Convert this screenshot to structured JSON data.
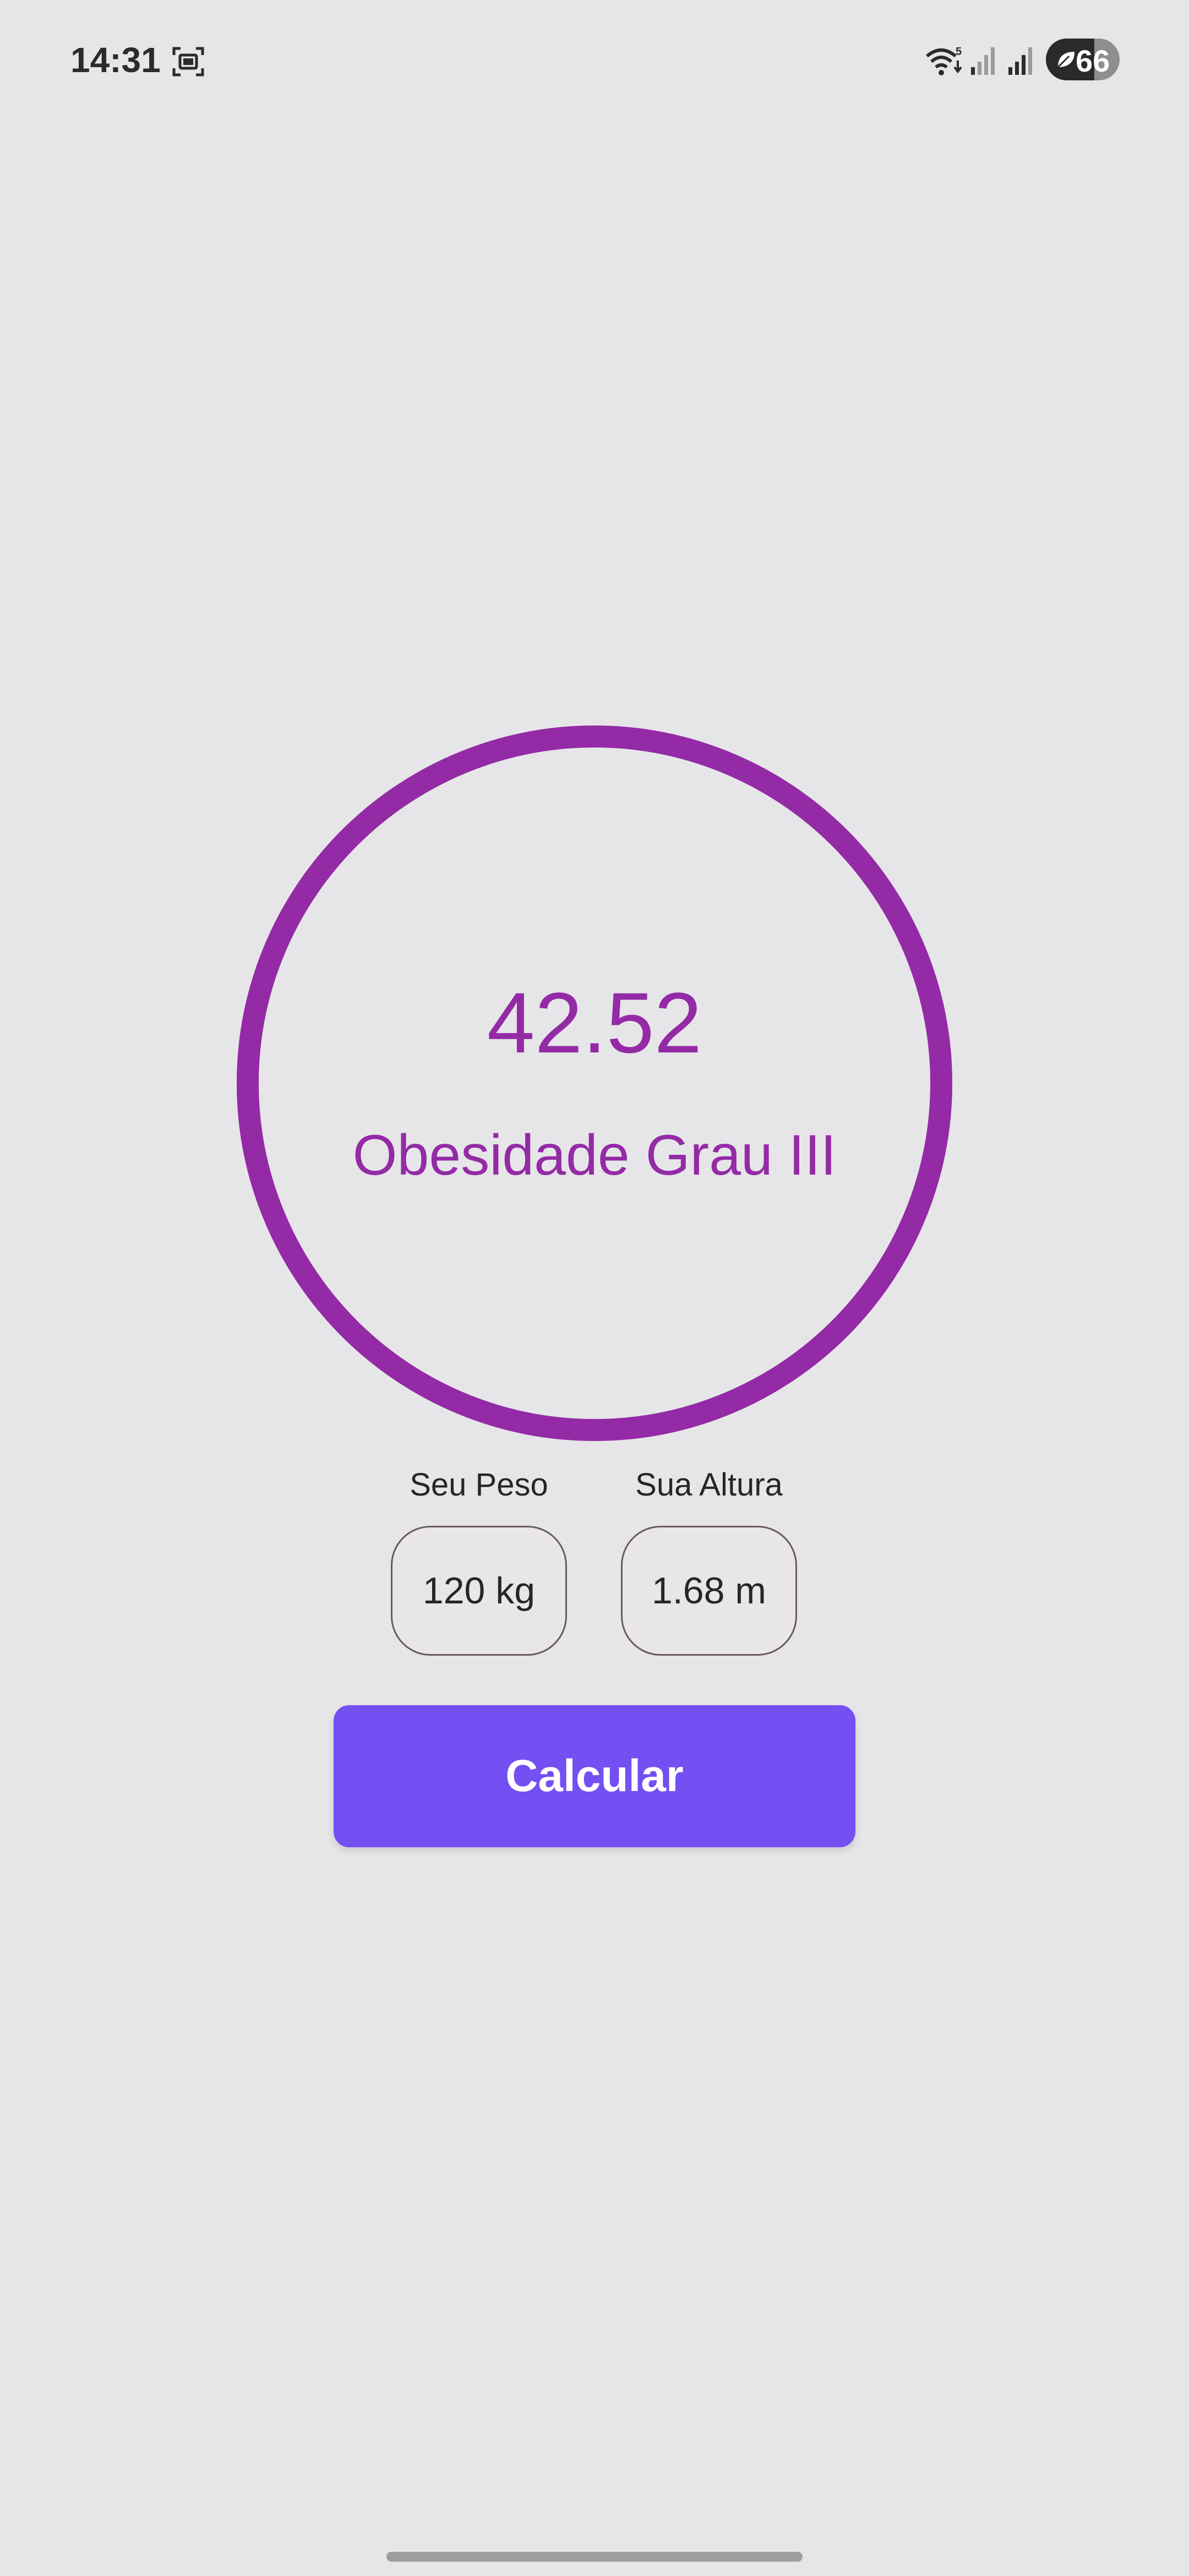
{
  "status_bar": {
    "time": "14:31",
    "battery_level": 66,
    "battery_text": "66",
    "wifi_badge": "5"
  },
  "result": {
    "bmi_value": "42.52",
    "category": "Obesidade Grau III",
    "color": "#942aa6"
  },
  "inputs": {
    "weight_label": "Seu Peso",
    "weight_value": "120 kg",
    "height_label": "Sua Altura",
    "height_value": "1.68 m"
  },
  "actions": {
    "calculate_label": "Calcular",
    "button_color": "#744ff2"
  },
  "icons": {
    "screen_record": "screen-record-icon",
    "wifi": "wifi-icon",
    "signal": "signal-icon",
    "battery_saver": "leaf-icon"
  }
}
